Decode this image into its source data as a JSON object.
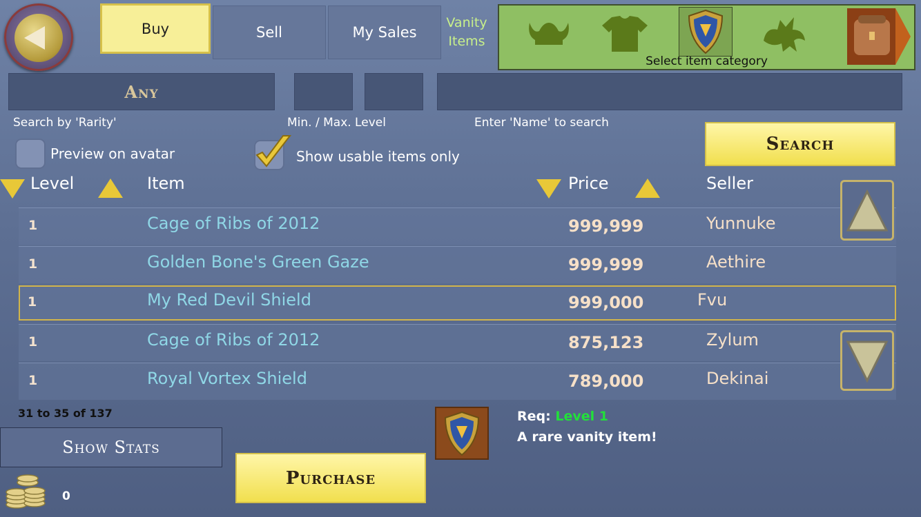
{
  "tabs": [
    {
      "label": "Buy",
      "active": true
    },
    {
      "label": "Sell"
    },
    {
      "label": "My Sales"
    }
  ],
  "vanity": {
    "line1": "Vanity",
    "line2": "Items"
  },
  "categories": {
    "icons": [
      "helmet-icon",
      "armor-icon",
      "shield-icon",
      "dragon-pet-icon",
      "backpack-icon"
    ],
    "selected": "shield-icon",
    "label": "Select item category"
  },
  "filters": {
    "rarity_value": "Any",
    "rarity_label": "Search by 'Rarity'",
    "level_label": "Min. / Max. Level",
    "name_label": "Enter 'Name' to search",
    "min_level": "",
    "max_level": "",
    "name_value": ""
  },
  "options": {
    "preview_label": "Preview on avatar",
    "preview_checked": false,
    "usable_label": "Show usable items only",
    "usable_checked": true
  },
  "search_label": "Search",
  "headers": {
    "level": "Level",
    "item": "Item",
    "price": "Price",
    "seller": "Seller"
  },
  "rows": [
    {
      "level": "1",
      "item": "Cage of Ribs of 2012",
      "price": "999,999",
      "seller": "Yunnuke"
    },
    {
      "level": "1",
      "item": "Golden Bone's Green Gaze",
      "price": "999,999",
      "seller": "Aethire"
    },
    {
      "level": "1",
      "item": "My Red Devil Shield",
      "price": "999,000",
      "seller": "Fvu",
      "selected": true
    },
    {
      "level": "1",
      "item": "Cage of Ribs of 2012",
      "price": "875,123",
      "seller": "Zylum"
    },
    {
      "level": "1",
      "item": "Royal Vortex Shield",
      "price": "789,000",
      "seller": "Dekinai"
    }
  ],
  "pagination": "31 to 35 of 137",
  "show_stats_label": "Show Stats",
  "purchase_label": "Purchase",
  "coins": "0",
  "selected_item": {
    "req_label": "Req:",
    "req_value": "Level 1",
    "description": "A rare vanity item!"
  },
  "colors": {
    "accent": "#f1df4e",
    "req_level": "#22e03a",
    "item_name": "#8fd7e6",
    "category_bg": "#8fbf63"
  }
}
